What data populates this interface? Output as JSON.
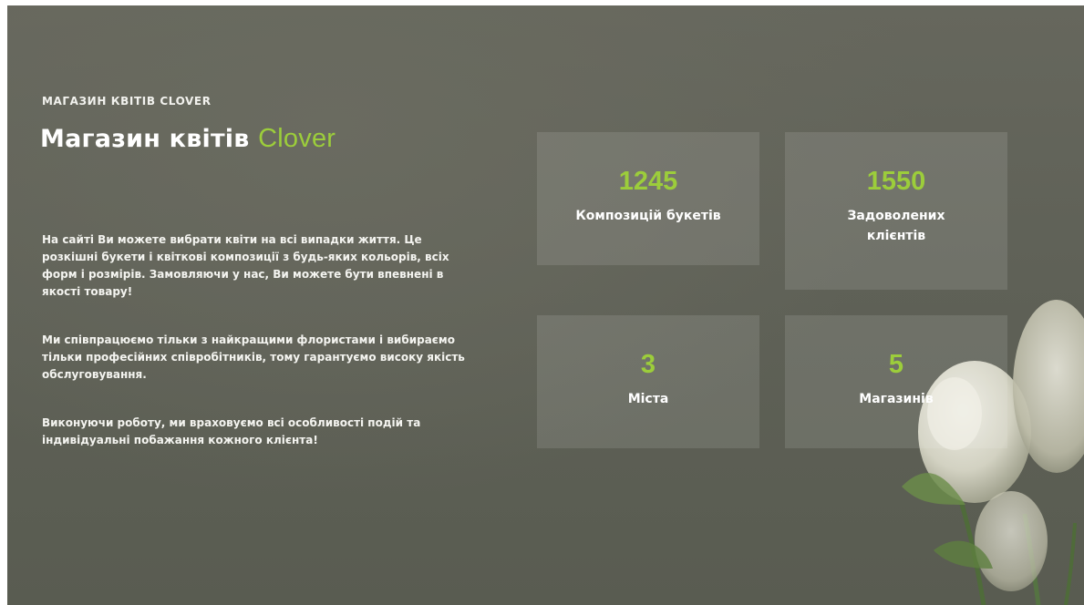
{
  "hero": {
    "eyebrow": "МАГАЗИН КВІТІВ CLOVER",
    "title_main": "Магазин квітів ",
    "title_accent": "Clover",
    "paragraphs": [
      "На сайті Ви можете вибрати квіти на всі випадки життя. Це розкішні букети і квіткові композиції з будь-яких кольорів, всіх форм і розмірів. Замовляючи у нас, Ви можете бути впевнені в якості товару!",
      "Ми співпрацюємо тільки з найкращими флористами і вибираємо тільки професійних співробітників, тому гарантуємо високу якість обслуговування.",
      "Виконуючи роботу, ми враховуємо всі особливості подій та індивідуальні побажання кожного клієнта!"
    ]
  },
  "stats": [
    {
      "value": "1245",
      "label": "Композицій букетів"
    },
    {
      "value": "1550",
      "label": "Задоволених клієнтів"
    },
    {
      "value": "3",
      "label": "Міста"
    },
    {
      "value": "5",
      "label": "Магазинів"
    }
  ],
  "colors": {
    "accent": "#9ccd3b",
    "background": "#5f6157",
    "text": "#ffffff"
  },
  "icons": {
    "decoration": "white-flowers-photo"
  }
}
